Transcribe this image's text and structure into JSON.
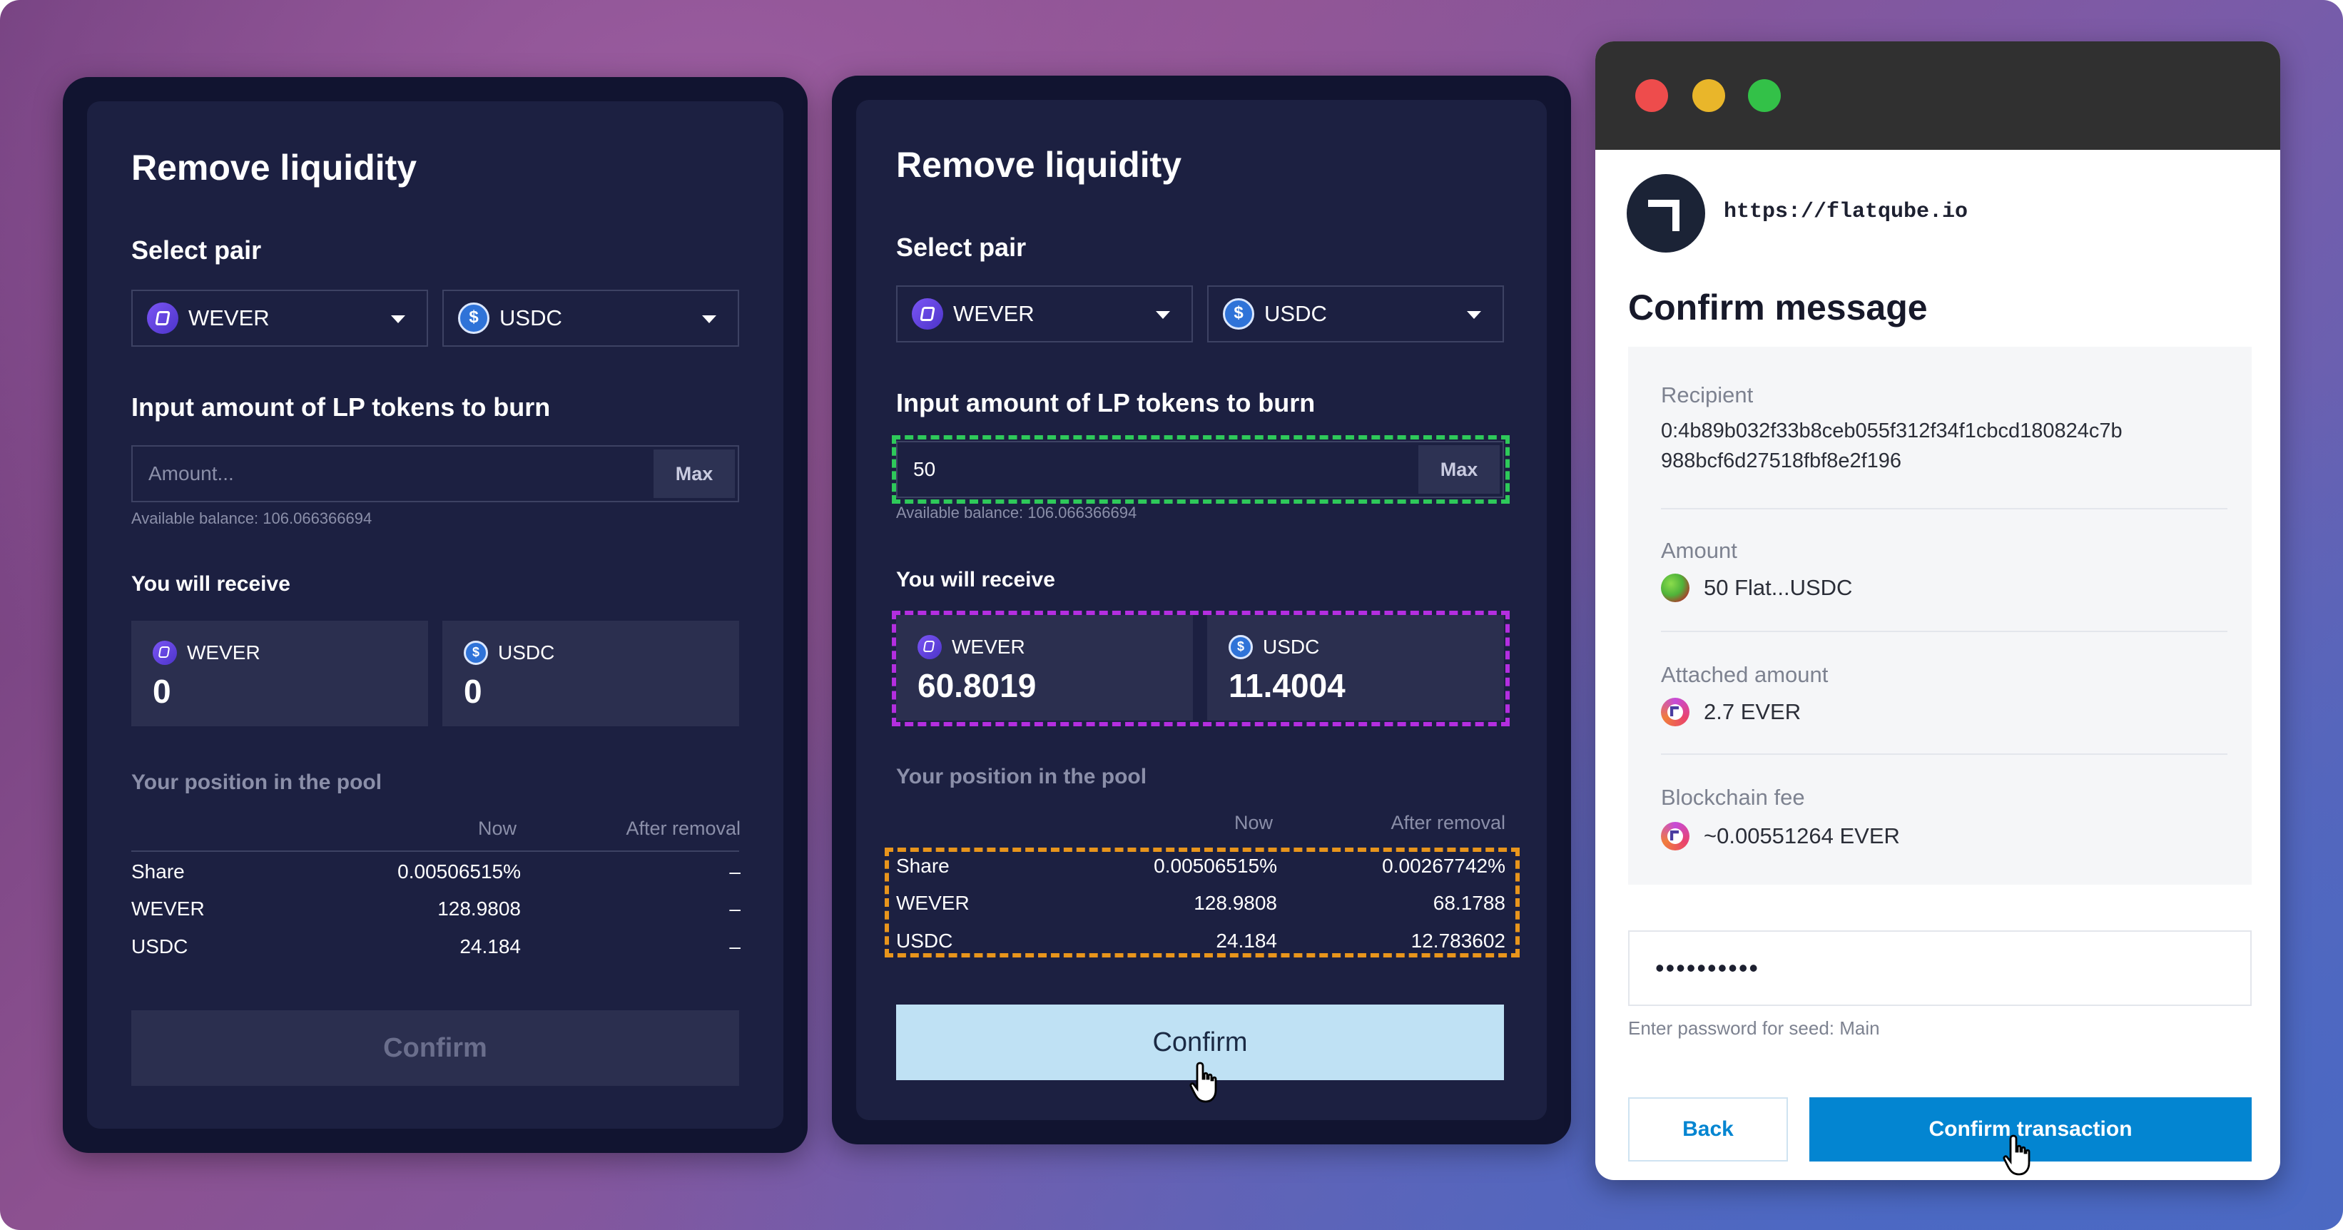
{
  "left_panel": {
    "title": "Remove liquidity",
    "select_pair_label": "Select pair",
    "token_a": "WEVER",
    "token_b": "USDC",
    "input_label": "Input amount of LP tokens to burn",
    "amount_placeholder": "Amount...",
    "max_label": "Max",
    "available_balance": "Available balance: 106.066366694",
    "receive_label": "You will receive",
    "receive": [
      {
        "token": "WEVER",
        "amount": "0"
      },
      {
        "token": "USDC",
        "amount": "0"
      }
    ],
    "position_label": "Your position in the pool",
    "col_now": "Now",
    "col_after": "After removal",
    "rows": [
      {
        "name": "Share",
        "now": "0.00506515%",
        "after": "–"
      },
      {
        "name": "WEVER",
        "now": "128.9808",
        "after": "–"
      },
      {
        "name": "USDC",
        "now": "24.184",
        "after": "–"
      }
    ],
    "confirm_label": "Confirm"
  },
  "middle_panel": {
    "title": "Remove liquidity",
    "select_pair_label": "Select pair",
    "token_a": "WEVER",
    "token_b": "USDC",
    "input_label": "Input amount of LP tokens to burn",
    "amount_value": "50",
    "max_label": "Max",
    "available_balance": "Available balance: 106.066366694",
    "receive_label": "You will receive",
    "receive": [
      {
        "token": "WEVER",
        "amount": "60.8019"
      },
      {
        "token": "USDC",
        "amount": "11.4004"
      }
    ],
    "position_label": "Your position in the pool",
    "col_now": "Now",
    "col_after": "After removal",
    "rows": [
      {
        "name": "Share",
        "now": "0.00506515%",
        "after": "0.00267742%"
      },
      {
        "name": "WEVER",
        "now": "128.9808",
        "after": "68.1788"
      },
      {
        "name": "USDC",
        "now": "24.184",
        "after": "12.783602"
      }
    ],
    "confirm_label": "Confirm",
    "highlight_colors": {
      "amount": "#2ec95a",
      "receive": "#b42ee0",
      "position": "#e8951c"
    }
  },
  "wallet": {
    "site_url": "https://flatqube.io",
    "heading": "Confirm message",
    "recipient_label": "Recipient",
    "recipient_line1": "0:4b89b032f33b8ceb055f312f34f1cbcd180824c7b",
    "recipient_line2": "988bcf6d27518fbf8e2f196",
    "amount_label": "Amount",
    "amount_value": "50 Flat...USDC",
    "attached_label": "Attached amount",
    "attached_value": "2.7 EVER",
    "fee_label": "Blockchain fee",
    "fee_value": "~0.00551264 EVER",
    "password_value": "••••••••••",
    "password_hint": "Enter password for seed: Main",
    "back_label": "Back",
    "confirm_tx_label": "Confirm transaction",
    "colors": {
      "primary": "#0385d1",
      "close": "#ee4c4c",
      "minimize": "#e9b62a",
      "maximize": "#33c148"
    }
  }
}
